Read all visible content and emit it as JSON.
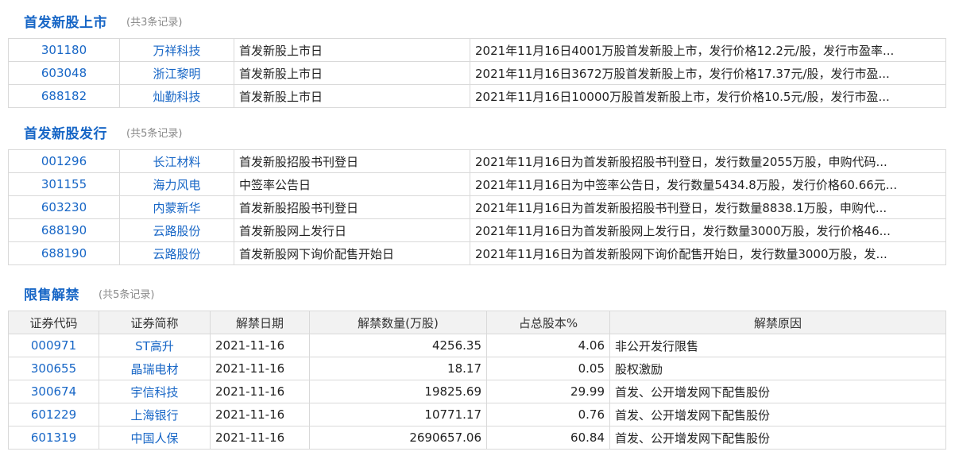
{
  "ipo_listing": {
    "title": "首发新股上市",
    "count": "(共3条记录)",
    "rows": [
      {
        "code": "301180",
        "name": "万祥科技",
        "event": "首发新股上市日",
        "desc": "2021年11月16日4001万股首发新股上市，发行价格12.2元/股，发行市盈率..."
      },
      {
        "code": "603048",
        "name": "浙江黎明",
        "event": "首发新股上市日",
        "desc": "2021年11月16日3672万股首发新股上市，发行价格17.37元/股，发行市盈..."
      },
      {
        "code": "688182",
        "name": "灿勤科技",
        "event": "首发新股上市日",
        "desc": "2021年11月16日10000万股首发新股上市，发行价格10.5元/股，发行市盈..."
      }
    ]
  },
  "ipo_issue": {
    "title": "首发新股发行",
    "count": "(共5条记录)",
    "rows": [
      {
        "code": "001296",
        "name": "长江材料",
        "event": "首发新股招股书刊登日",
        "desc": "2021年11月16日为首发新股招股书刊登日，发行数量2055万股，申购代码..."
      },
      {
        "code": "301155",
        "name": "海力风电",
        "event": "中签率公告日",
        "desc": "2021年11月16日为中签率公告日，发行数量5434.8万股，发行价格60.66元..."
      },
      {
        "code": "603230",
        "name": "内蒙新华",
        "event": "首发新股招股书刊登日",
        "desc": "2021年11月16日为首发新股招股书刊登日，发行数量8838.1万股，申购代..."
      },
      {
        "code": "688190",
        "name": "云路股份",
        "event": "首发新股网上发行日",
        "desc": "2021年11月16日为首发新股网上发行日，发行数量3000万股，发行价格46..."
      },
      {
        "code": "688190",
        "name": "云路股份",
        "event": "首发新股网下询价配售开始日",
        "desc": "2021年11月16日为首发新股网下询价配售开始日，发行数量3000万股，发..."
      }
    ]
  },
  "unlock": {
    "title": "限售解禁",
    "count": "(共5条记录)",
    "headers": [
      "证券代码",
      "证券简称",
      "解禁日期",
      "解禁数量(万股)",
      "占总股本%",
      "解禁原因"
    ],
    "rows": [
      {
        "code": "000971",
        "name": "ST高升",
        "date": "2021-11-16",
        "qty": "4256.35",
        "pct": "4.06",
        "reason": "非公开发行限售"
      },
      {
        "code": "300655",
        "name": "晶瑞电材",
        "date": "2021-11-16",
        "qty": "18.17",
        "pct": "0.05",
        "reason": "股权激励"
      },
      {
        "code": "300674",
        "name": "宇信科技",
        "date": "2021-11-16",
        "qty": "19825.69",
        "pct": "29.99",
        "reason": "首发、公开增发网下配售股份"
      },
      {
        "code": "601229",
        "name": "上海银行",
        "date": "2021-11-16",
        "qty": "10771.17",
        "pct": "0.76",
        "reason": "首发、公开增发网下配售股份"
      },
      {
        "code": "601319",
        "name": "中国人保",
        "date": "2021-11-16",
        "qty": "2690657.06",
        "pct": "60.84",
        "reason": "首发、公开增发网下配售股份"
      }
    ]
  }
}
